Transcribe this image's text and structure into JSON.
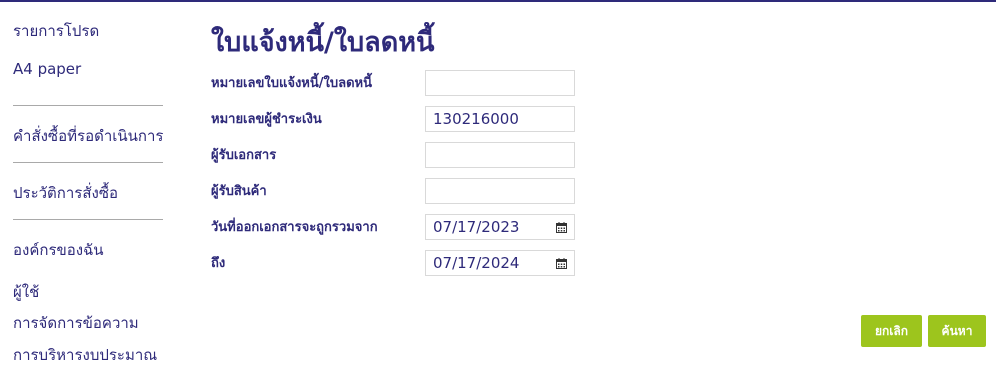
{
  "sidebar": {
    "items": [
      {
        "label": "รายการโปรด"
      },
      {
        "label": "A4 paper"
      },
      {
        "label": "คำสั่งซื้อที่รอดำเนินการ"
      },
      {
        "label": "ประวัติการสั่งซื้อ"
      },
      {
        "label": "องค์กรของฉัน"
      },
      {
        "label": "ผู้ใช้"
      },
      {
        "label": "การจัดการข้อความ"
      },
      {
        "label": "การบริหารงบประมาณ"
      }
    ]
  },
  "page": {
    "title": "ใบแจ้งหนี้/ใบลดหนี้"
  },
  "form": {
    "invoice_number": {
      "label": "หมายเลขใบแจ้งหนี้/ใบลดหนี้",
      "value": ""
    },
    "payer_number": {
      "label": "หมายเลขผู้ชำระเงิน",
      "value": "130216000"
    },
    "document_recipient": {
      "label": "ผู้รับเอกสาร",
      "value": ""
    },
    "goods_recipient": {
      "label": "ผู้รับสินค้า",
      "value": ""
    },
    "date_from": {
      "label": "วันที่ออกเอกสารจะถูกรวมจาก",
      "value": "07/17/2023"
    },
    "date_to": {
      "label": "ถึง",
      "value": "07/17/2024"
    }
  },
  "actions": {
    "cancel_label": "ยกเลิก",
    "search_label": "ค้นหา"
  },
  "colors": {
    "primary_text": "#2e2a7a",
    "button_green": "#9dc51d"
  },
  "icons": {
    "date_picker": "calendar-icon"
  }
}
